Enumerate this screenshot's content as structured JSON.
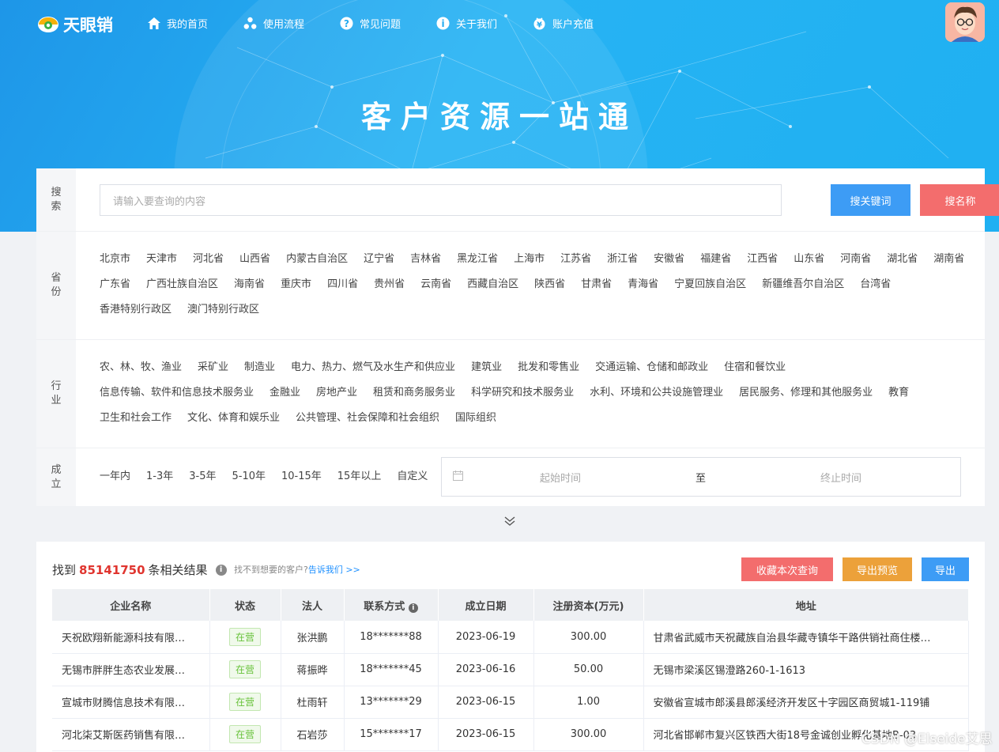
{
  "nav": {
    "brand": "天眼销",
    "items": [
      {
        "label": "我的首页",
        "icon": "home-icon"
      },
      {
        "label": "使用流程",
        "icon": "flow-icon"
      },
      {
        "label": "常见问题",
        "icon": "question-icon"
      },
      {
        "label": "关于我们",
        "icon": "info-icon"
      },
      {
        "label": "账户充值",
        "icon": "wallet-icon"
      }
    ]
  },
  "hero": {
    "title": "客户资源一站通"
  },
  "search": {
    "label": "搜索",
    "placeholder": "请输入要查询的内容",
    "keyword_btn": "搜关键词",
    "name_btn": "搜名称"
  },
  "province": {
    "label": "省份",
    "items": [
      "北京市",
      "天津市",
      "河北省",
      "山西省",
      "内蒙古自治区",
      "辽宁省",
      "吉林省",
      "黑龙江省",
      "上海市",
      "江苏省",
      "浙江省",
      "安徽省",
      "福建省",
      "江西省",
      "山东省",
      "河南省",
      "湖北省",
      "湖南省",
      "广东省",
      "广西壮族自治区",
      "海南省",
      "重庆市",
      "四川省",
      "贵州省",
      "云南省",
      "西藏自治区",
      "陕西省",
      "甘肃省",
      "青海省",
      "宁夏回族自治区",
      "新疆维吾尔自治区",
      "台湾省",
      "香港特别行政区",
      "澳门特别行政区"
    ]
  },
  "industry": {
    "label": "行业",
    "items": [
      "农、林、牧、渔业",
      "采矿业",
      "制造业",
      "电力、热力、燃气及水生产和供应业",
      "建筑业",
      "批发和零售业",
      "交通运输、仓储和邮政业",
      "住宿和餐饮业",
      "信息传输、软件和信息技术服务业",
      "金融业",
      "房地产业",
      "租赁和商务服务业",
      "科学研究和技术服务业",
      "水利、环境和公共设施管理业",
      "居民服务、修理和其他服务业",
      "教育",
      "卫生和社会工作",
      "文化、体育和娱乐业",
      "公共管理、社会保障和社会组织",
      "国际组织"
    ]
  },
  "established": {
    "label": "成立",
    "items": [
      "一年内",
      "1-3年",
      "3-5年",
      "5-10年",
      "10-15年",
      "15年以上",
      "自定义"
    ],
    "start_placeholder": "起始时间",
    "separator": "至",
    "end_placeholder": "终止时间"
  },
  "results": {
    "prefix": "找到",
    "count": "85141750",
    "suffix": "条相关结果",
    "hint": "找不到想要的客户?",
    "hint_link": "告诉我们 >>",
    "save_btn": "收藏本次查询",
    "preview_btn": "导出预览",
    "export_btn": "导出",
    "columns": [
      "企业名称",
      "状态",
      "法人",
      "联系方式",
      "成立日期",
      "注册资本(万元)",
      "地址"
    ],
    "rows": [
      [
        "天祝欧翔新能源科技有限…",
        "在营",
        "张洪鹏",
        "18*******88",
        "2023-06-19",
        "300.00",
        "甘肃省武威市天祝藏族自治县华藏寺镇华干路供销社商住楼…"
      ],
      [
        "无锡市胖胖生态农业发展…",
        "在营",
        "蒋振晔",
        "18*******45",
        "2023-06-16",
        "50.00",
        "无锡市梁溪区锡澄路260-1-1613"
      ],
      [
        "宣城市财腾信息技术有限…",
        "在营",
        "杜雨轩",
        "13*******29",
        "2023-06-15",
        "1.00",
        "安徽省宣城市郎溪县郎溪经济开发区十字园区商贸城1-119铺"
      ],
      [
        "河北柒艾斯医药销售有限…",
        "在营",
        "石岩莎",
        "15*******17",
        "2023-06-15",
        "300.00",
        "河北省邯郸市复兴区铁西大街18号金诚创业孵化基地B-03"
      ]
    ]
  },
  "watermark": "CSDN @Elseide艾思",
  "colors": {
    "blue_btn": "#3d9cf5",
    "red_btn": "#f36d6d",
    "orange_btn": "#eca13a",
    "hero": "#22abf0"
  }
}
